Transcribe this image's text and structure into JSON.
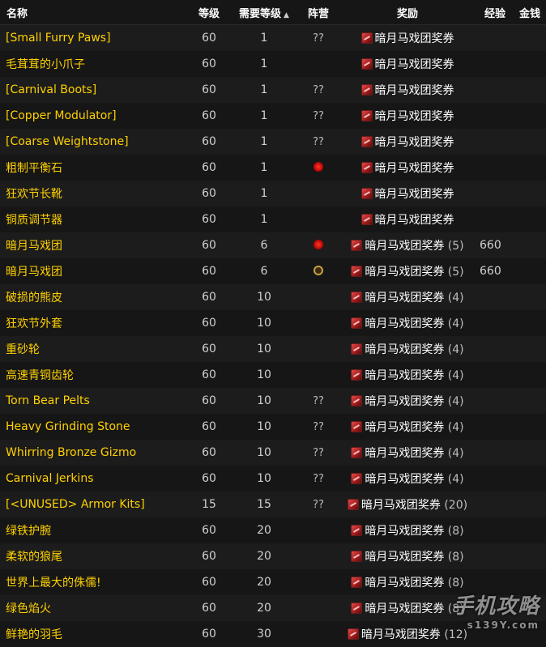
{
  "columns": {
    "name": "名称",
    "level": "等级",
    "req_level": "需要等级",
    "faction": "阵营",
    "reward": "奖励",
    "xp": "经验",
    "money": "金钱"
  },
  "rows": [
    {
      "name": "[Small Furry Paws]",
      "level": "60",
      "req": "1",
      "faction": "??",
      "faction_icon": "",
      "reward": "暗月马戏团奖券",
      "count": "",
      "xp": ""
    },
    {
      "name": "毛茸茸的小爪子",
      "level": "60",
      "req": "1",
      "faction": "",
      "faction_icon": "",
      "reward": "暗月马戏团奖券",
      "count": "",
      "xp": ""
    },
    {
      "name": "[Carnival Boots]",
      "level": "60",
      "req": "1",
      "faction": "??",
      "faction_icon": "",
      "reward": "暗月马戏团奖券",
      "count": "",
      "xp": ""
    },
    {
      "name": "[Copper Modulator]",
      "level": "60",
      "req": "1",
      "faction": "??",
      "faction_icon": "",
      "reward": "暗月马戏团奖券",
      "count": "",
      "xp": ""
    },
    {
      "name": "[Coarse Weightstone]",
      "level": "60",
      "req": "1",
      "faction": "??",
      "faction_icon": "",
      "reward": "暗月马戏团奖券",
      "count": "",
      "xp": ""
    },
    {
      "name": "粗制平衡石",
      "level": "60",
      "req": "1",
      "faction": "",
      "faction_icon": "horde",
      "reward": "暗月马戏团奖券",
      "count": "",
      "xp": ""
    },
    {
      "name": "狂欢节长靴",
      "level": "60",
      "req": "1",
      "faction": "",
      "faction_icon": "",
      "reward": "暗月马戏团奖券",
      "count": "",
      "xp": ""
    },
    {
      "name": "铜质调节器",
      "level": "60",
      "req": "1",
      "faction": "",
      "faction_icon": "",
      "reward": "暗月马戏团奖券",
      "count": "",
      "xp": ""
    },
    {
      "name": "暗月马戏团",
      "level": "60",
      "req": "6",
      "faction": "",
      "faction_icon": "horde",
      "reward": "暗月马戏团奖券",
      "count": "(5)",
      "xp": "660"
    },
    {
      "name": "暗月马戏团",
      "level": "60",
      "req": "6",
      "faction": "",
      "faction_icon": "alliance",
      "reward": "暗月马戏团奖券",
      "count": "(5)",
      "xp": "660"
    },
    {
      "name": "破损的熊皮",
      "level": "60",
      "req": "10",
      "faction": "",
      "faction_icon": "",
      "reward": "暗月马戏团奖券",
      "count": "(4)",
      "xp": ""
    },
    {
      "name": "狂欢节外套",
      "level": "60",
      "req": "10",
      "faction": "",
      "faction_icon": "",
      "reward": "暗月马戏团奖券",
      "count": "(4)",
      "xp": ""
    },
    {
      "name": "重砂轮",
      "level": "60",
      "req": "10",
      "faction": "",
      "faction_icon": "",
      "reward": "暗月马戏团奖券",
      "count": "(4)",
      "xp": ""
    },
    {
      "name": "高速青铜齿轮",
      "level": "60",
      "req": "10",
      "faction": "",
      "faction_icon": "",
      "reward": "暗月马戏团奖券",
      "count": "(4)",
      "xp": ""
    },
    {
      "name": "Torn Bear Pelts",
      "level": "60",
      "req": "10",
      "faction": "??",
      "faction_icon": "",
      "reward": "暗月马戏团奖券",
      "count": "(4)",
      "xp": ""
    },
    {
      "name": "Heavy Grinding Stone",
      "level": "60",
      "req": "10",
      "faction": "??",
      "faction_icon": "",
      "reward": "暗月马戏团奖券",
      "count": "(4)",
      "xp": ""
    },
    {
      "name": "Whirring Bronze Gizmo",
      "level": "60",
      "req": "10",
      "faction": "??",
      "faction_icon": "",
      "reward": "暗月马戏团奖券",
      "count": "(4)",
      "xp": ""
    },
    {
      "name": "Carnival Jerkins",
      "level": "60",
      "req": "10",
      "faction": "??",
      "faction_icon": "",
      "reward": "暗月马戏团奖券",
      "count": "(4)",
      "xp": ""
    },
    {
      "name": "[<UNUSED> Armor Kits]",
      "level": "15",
      "req": "15",
      "faction": "??",
      "faction_icon": "",
      "reward": "暗月马戏团奖券",
      "count": "(20)",
      "xp": ""
    },
    {
      "name": "绿铁护腕",
      "level": "60",
      "req": "20",
      "faction": "",
      "faction_icon": "",
      "reward": "暗月马戏团奖券",
      "count": "(8)",
      "xp": ""
    },
    {
      "name": "柔软的狼尾",
      "level": "60",
      "req": "20",
      "faction": "",
      "faction_icon": "",
      "reward": "暗月马戏团奖券",
      "count": "(8)",
      "xp": ""
    },
    {
      "name": "世界上最大的侏儒!",
      "level": "60",
      "req": "20",
      "faction": "",
      "faction_icon": "",
      "reward": "暗月马戏团奖券",
      "count": "(8)",
      "xp": ""
    },
    {
      "name": "绿色焰火",
      "level": "60",
      "req": "20",
      "faction": "",
      "faction_icon": "",
      "reward": "暗月马戏团奖券",
      "count": "(8)",
      "xp": ""
    },
    {
      "name": "鲜艳的羽毛",
      "level": "60",
      "req": "30",
      "faction": "",
      "faction_icon": "",
      "reward": "暗月马戏团奖券",
      "count": "(12)",
      "xp": ""
    }
  ],
  "sort_arrow": "▲",
  "watermark": {
    "brand": "手机攻略",
    "site": "s139Y.com"
  },
  "colors": {
    "name": "#ffd100",
    "background": "#161616",
    "row_alt": "#1c1c1c"
  }
}
